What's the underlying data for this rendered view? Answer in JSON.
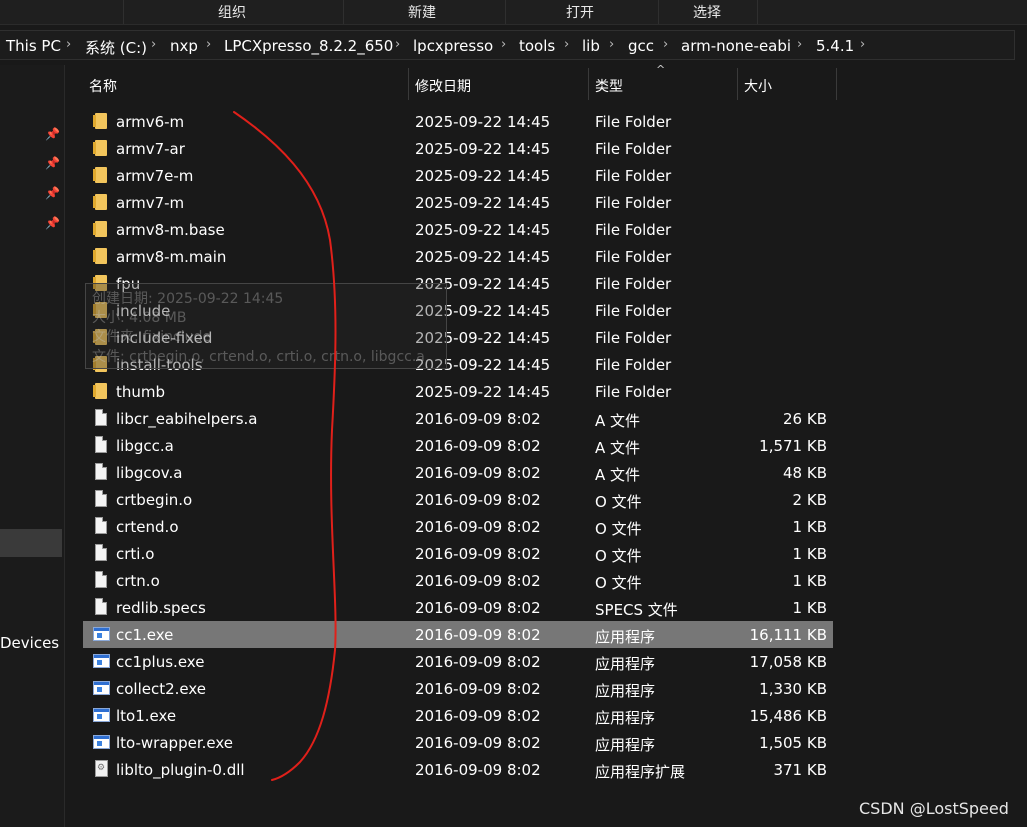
{
  "ribbon": {
    "buttons": [
      "组织",
      "新建",
      "打开",
      "选择"
    ]
  },
  "address": {
    "crumbs": [
      "This PC",
      "系统 (C:)",
      "nxp",
      "LPCXpresso_8.2.2_650",
      "lpcxpresso",
      "tools",
      "lib",
      "gcc",
      "arm-none-eabi",
      "5.4.1"
    ]
  },
  "nav": {
    "devices_label": "Devices"
  },
  "columns": {
    "name": "名称",
    "date": "修改日期",
    "type": "类型",
    "size": "大小"
  },
  "files": [
    {
      "name": "armv6-m",
      "date": "2025-09-22 14:45",
      "type": "File Folder",
      "size": "",
      "icon": "folder"
    },
    {
      "name": "armv7-ar",
      "date": "2025-09-22 14:45",
      "type": "File Folder",
      "size": "",
      "icon": "folder"
    },
    {
      "name": "armv7e-m",
      "date": "2025-09-22 14:45",
      "type": "File Folder",
      "size": "",
      "icon": "folder"
    },
    {
      "name": "armv7-m",
      "date": "2025-09-22 14:45",
      "type": "File Folder",
      "size": "",
      "icon": "folder"
    },
    {
      "name": "armv8-m.base",
      "date": "2025-09-22 14:45",
      "type": "File Folder",
      "size": "",
      "icon": "folder"
    },
    {
      "name": "armv8-m.main",
      "date": "2025-09-22 14:45",
      "type": "File Folder",
      "size": "",
      "icon": "folder"
    },
    {
      "name": "fpu",
      "date": "2025-09-22 14:45",
      "type": "File Folder",
      "size": "",
      "icon": "folder"
    },
    {
      "name": "include",
      "date": "2025-09-22 14:45",
      "type": "File Folder",
      "size": "",
      "icon": "folder"
    },
    {
      "name": "include-fixed",
      "date": "2025-09-22 14:45",
      "type": "File Folder",
      "size": "",
      "icon": "folder"
    },
    {
      "name": "install-tools",
      "date": "2025-09-22 14:45",
      "type": "File Folder",
      "size": "",
      "icon": "folder"
    },
    {
      "name": "thumb",
      "date": "2025-09-22 14:45",
      "type": "File Folder",
      "size": "",
      "icon": "folder"
    },
    {
      "name": "libcr_eabihelpers.a",
      "date": "2016-09-09 8:02",
      "type": "A 文件",
      "size": "26 KB",
      "icon": "file"
    },
    {
      "name": "libgcc.a",
      "date": "2016-09-09 8:02",
      "type": "A 文件",
      "size": "1,571 KB",
      "icon": "file"
    },
    {
      "name": "libgcov.a",
      "date": "2016-09-09 8:02",
      "type": "A 文件",
      "size": "48 KB",
      "icon": "file"
    },
    {
      "name": "crtbegin.o",
      "date": "2016-09-09 8:02",
      "type": "O 文件",
      "size": "2 KB",
      "icon": "file"
    },
    {
      "name": "crtend.o",
      "date": "2016-09-09 8:02",
      "type": "O 文件",
      "size": "1 KB",
      "icon": "file"
    },
    {
      "name": "crti.o",
      "date": "2016-09-09 8:02",
      "type": "O 文件",
      "size": "1 KB",
      "icon": "file"
    },
    {
      "name": "crtn.o",
      "date": "2016-09-09 8:02",
      "type": "O 文件",
      "size": "1 KB",
      "icon": "file"
    },
    {
      "name": "redlib.specs",
      "date": "2016-09-09 8:02",
      "type": "SPECS 文件",
      "size": "1 KB",
      "icon": "file"
    },
    {
      "name": "cc1.exe",
      "date": "2016-09-09 8:02",
      "type": "应用程序",
      "size": "16,111 KB",
      "icon": "exe",
      "selected": true
    },
    {
      "name": "cc1plus.exe",
      "date": "2016-09-09 8:02",
      "type": "应用程序",
      "size": "17,058 KB",
      "icon": "exe"
    },
    {
      "name": "collect2.exe",
      "date": "2016-09-09 8:02",
      "type": "应用程序",
      "size": "1,330 KB",
      "icon": "exe"
    },
    {
      "name": "lto1.exe",
      "date": "2016-09-09 8:02",
      "type": "应用程序",
      "size": "15,486 KB",
      "icon": "exe"
    },
    {
      "name": "lto-wrapper.exe",
      "date": "2016-09-09 8:02",
      "type": "应用程序",
      "size": "1,505 KB",
      "icon": "exe"
    },
    {
      "name": "liblto_plugin-0.dll",
      "date": "2016-09-09 8:02",
      "type": "应用程序扩展",
      "size": "371 KB",
      "icon": "dll"
    }
  ],
  "ghost_tooltip": {
    "lines": [
      "创建日期: 2025-09-22 14:45",
      "大小: 4.08 MB",
      "文件夹: fixinclude",
      "文件: crtbegin.o, crtend.o, crti.o, crtn.o, libgcc.a"
    ]
  },
  "watermark": "CSDN @LostSpeed",
  "colors": {
    "background": "#191919",
    "selected_row": "#777777",
    "annotation": "#e0201a"
  }
}
